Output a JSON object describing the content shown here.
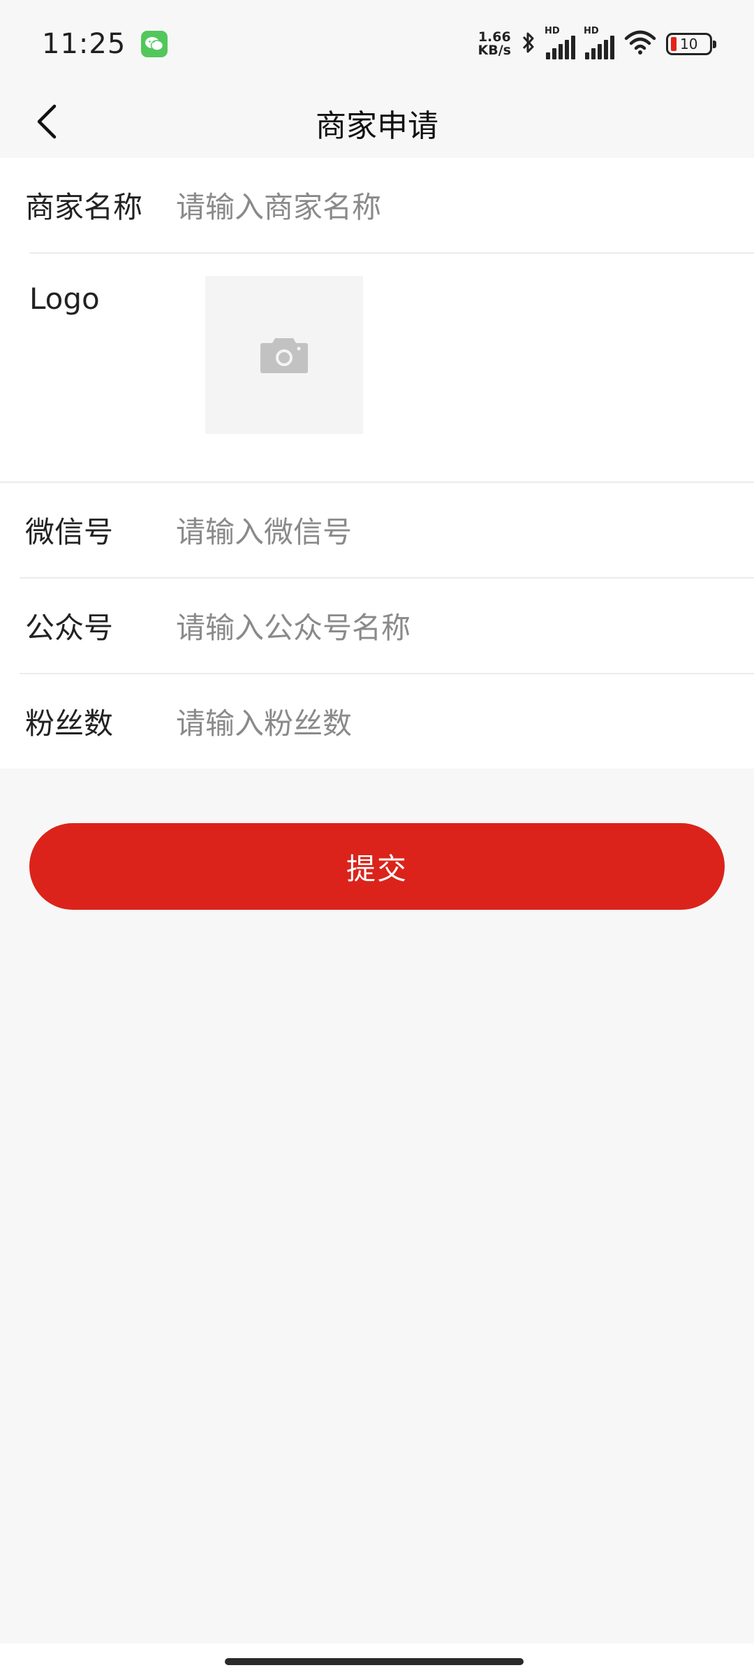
{
  "status_bar": {
    "time": "11:25",
    "net_speed_value": "1.66",
    "net_speed_unit": "KB/s",
    "signal_label": "HD",
    "battery": "10",
    "icons": [
      "wechat-icon",
      "bluetooth-icon",
      "signal-icon",
      "wifi-icon",
      "battery-icon"
    ]
  },
  "nav": {
    "title": "商家申请",
    "back_icon": "chevron-left-icon"
  },
  "form": {
    "merchant_name": {
      "label": "商家名称",
      "placeholder": "请输入商家名称"
    },
    "logo": {
      "label": "Logo",
      "icon": "camera-icon"
    },
    "wechat_id": {
      "label": "微信号",
      "placeholder": "请输入微信号"
    },
    "official_account": {
      "label": "公众号",
      "placeholder": "请输入公众号名称"
    },
    "followers": {
      "label": "粉丝数",
      "placeholder": "请输入粉丝数"
    }
  },
  "submit_label": "提交",
  "colors": {
    "accent": "#db231b",
    "background": "#f7f7f7",
    "placeholder": "#8a8a8a",
    "wechat_green": "#52c75b"
  }
}
